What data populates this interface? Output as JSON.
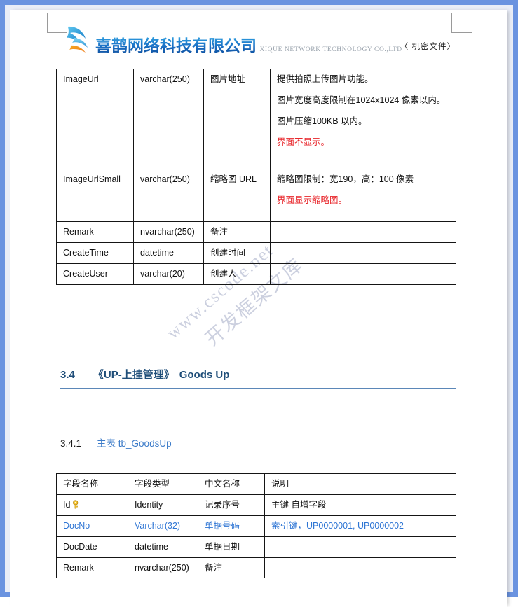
{
  "page": {
    "confidential_mark": "〈 机密文件〉",
    "watermark_line1": "www.cscode.net",
    "watermark_line2": "开发框架文库",
    "frame_color": "#6a93e0",
    "heading_color": "#1f4e79",
    "table_header_bg": "#f8cbad",
    "note_color": "#e8262b",
    "link_blue": "#2e75d4"
  },
  "logo": {
    "cn_name": "喜鹊网络科技有限公司",
    "en_name": "XIQUE NETWORK TECHNOLOGY CO.,LTD"
  },
  "table_goods_fields": {
    "rows": [
      {
        "name": "ImageUrl",
        "type": "varchar(250)",
        "cn": "图片地址",
        "desc_paragraphs": [
          "提供拍照上传图片功能。",
          "图片宽度高度限制在1024x1024 像素以内。",
          "图片压缩100KB 以内。"
        ],
        "desc_note": "界面不显示。"
      },
      {
        "name": "ImageUrlSmall",
        "type": "varchar(250)",
        "cn": "缩略图 URL",
        "desc_paragraphs": [
          "缩略图限制：宽190，高：100 像素"
        ],
        "desc_note": "界面显示缩略图。"
      },
      {
        "name": "Remark",
        "type": "nvarchar(250)",
        "cn": "备注",
        "desc_paragraphs": [],
        "desc_note": ""
      },
      {
        "name": "CreateTime",
        "type": "datetime",
        "cn": "创建时间",
        "desc_paragraphs": [],
        "desc_note": ""
      },
      {
        "name": "CreateUser",
        "type": "varchar(20)",
        "cn": "创建人",
        "desc_paragraphs": [],
        "desc_note": ""
      }
    ]
  },
  "section_3_4": {
    "number": "3.4",
    "title_cn": "《UP-上挂管理》",
    "title_en": "Goods Up"
  },
  "section_3_4_1": {
    "number": "3.4.1",
    "label": "主表 tb_GoodsUp"
  },
  "table_goodsup_fields": {
    "headers": [
      "字段名称",
      "字段类型",
      "中文名称",
      "说明"
    ],
    "rows": [
      {
        "name": "Id",
        "key_icon": "key-icon",
        "type": "Identity",
        "cn": "记录序号",
        "desc": "主键 自增字段",
        "blue": false
      },
      {
        "name": "DocNo",
        "key_icon": "",
        "type": "Varchar(32)",
        "cn": "单据号码",
        "desc": "索引键，UP0000001, UP0000002",
        "blue": true
      },
      {
        "name": "DocDate",
        "key_icon": "",
        "type": "datetime",
        "cn": "单据日期",
        "desc": "",
        "blue": false
      },
      {
        "name": "Remark",
        "key_icon": "",
        "type": "nvarchar(250)",
        "cn": "备注",
        "desc": "",
        "blue": false
      }
    ]
  }
}
